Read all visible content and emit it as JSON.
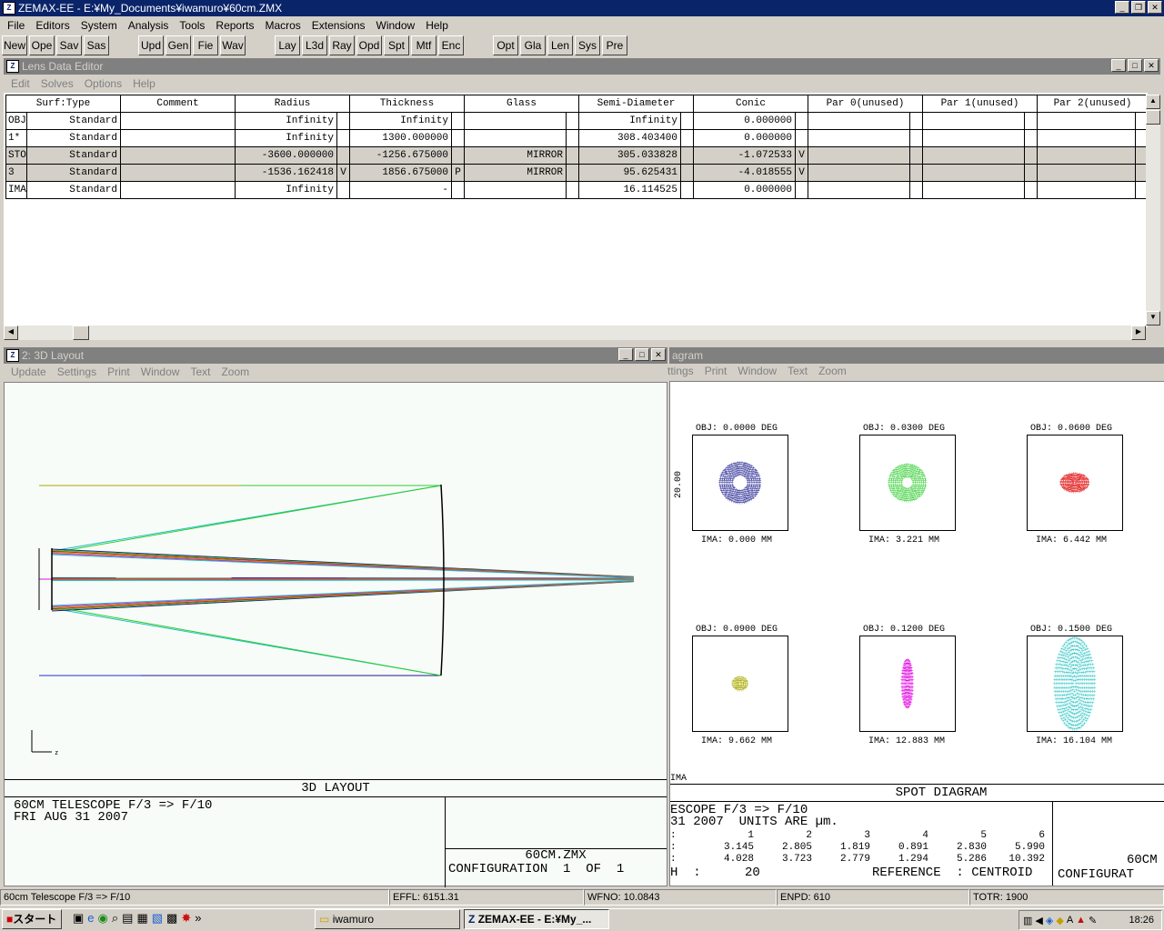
{
  "app": {
    "title": "ZEMAX-EE - E:¥My_Documents¥iwamuro¥60cm.ZMX"
  },
  "menu": [
    "File",
    "Editors",
    "System",
    "Analysis",
    "Tools",
    "Reports",
    "Macros",
    "Extensions",
    "Window",
    "Help"
  ],
  "toolbar": {
    "group1": [
      "New",
      "Ope",
      "Sav",
      "Sas"
    ],
    "group2": [
      "Upd",
      "Gen",
      "Fie",
      "Wav"
    ],
    "group3": [
      "Lay",
      "L3d",
      "Ray",
      "Opd",
      "Spt",
      "Mtf",
      "Enc"
    ],
    "group4": [
      "Opt",
      "Gla",
      "Len",
      "Sys",
      "Pre"
    ]
  },
  "lde": {
    "title": "Lens Data Editor",
    "menu": [
      "Edit",
      "Solves",
      "Options",
      "Help"
    ],
    "headers": [
      "Surf:Type",
      "Comment",
      "Radius",
      "Thickness",
      "Glass",
      "Semi-Diameter",
      "Conic",
      "Par 0(unused)",
      "Par 1(unused)",
      "Par 2(unused)"
    ],
    "rows": [
      {
        "surf": "OBJ",
        "type": "Standard",
        "comment": "",
        "radius": "Infinity",
        "rs": "",
        "thick": "Infinity",
        "ts": "",
        "glass": "",
        "semi": "Infinity",
        "conic": "0.000000",
        "cs": ""
      },
      {
        "surf": "1*",
        "type": "Standard",
        "comment": "",
        "radius": "Infinity",
        "rs": "",
        "thick": "1300.000000",
        "ts": "",
        "glass": "",
        "semi": "308.403400",
        "conic": "0.000000",
        "cs": ""
      },
      {
        "surf": "STO",
        "type": "Standard",
        "comment": "",
        "radius": "-3600.000000",
        "rs": "",
        "thick": "-1256.675000",
        "ts": "",
        "glass": "MIRROR",
        "semi": "305.033828",
        "conic": "-1.072533",
        "cs": "V"
      },
      {
        "surf": "3",
        "type": "Standard",
        "comment": "",
        "radius": "-1536.162418",
        "rs": "V",
        "thick": "1856.675000",
        "ts": "P",
        "glass": "MIRROR",
        "semi": "95.625431",
        "conic": "-4.018555",
        "cs": "V"
      },
      {
        "surf": "IMA",
        "type": "Standard",
        "comment": "",
        "radius": "Infinity",
        "rs": "",
        "thick": "-",
        "ts": "",
        "glass": "",
        "semi": "16.114525",
        "conic": "0.000000",
        "cs": ""
      }
    ]
  },
  "layout": {
    "title": "2: 3D Layout",
    "menu": [
      "Update",
      "Settings",
      "Print",
      "Window",
      "Text",
      "Zoom"
    ],
    "caption": "3D LAYOUT",
    "info1": "60CM TELESCOPE F/3 => F/10",
    "info2": "FRI AUG 31 2007",
    "file": "60CM.ZMX",
    "config": "CONFIGURATION  1  OF  1",
    "axis_z": "z"
  },
  "spot": {
    "title": "agram",
    "menu": [
      "ttings",
      "Print",
      "Window",
      "Text",
      "Zoom"
    ],
    "caption": "SPOT DIAGRAM",
    "scale_label": "20.00",
    "fields": [
      {
        "obj": "OBJ: 0.0000 DEG",
        "ima": "IMA: 0.000 MM",
        "color": "#1a1a8c"
      },
      {
        "obj": "OBJ: 0.0300 DEG",
        "ima": "IMA: 3.221 MM",
        "color": "#2ecc2e"
      },
      {
        "obj": "OBJ: 0.0600 DEG",
        "ima": "IMA: 6.442 MM",
        "color": "#e01010"
      },
      {
        "obj": "OBJ: 0.0900 DEG",
        "ima": "IMA: 9.662 MM",
        "color": "#a8a800"
      },
      {
        "obj": "OBJ: 0.1200 DEG",
        "ima": "IMA: 12.883 MM",
        "color": "#e010e0"
      },
      {
        "obj": "OBJ: 0.1500 DEG",
        "ima": "IMA: 16.104 MM",
        "color": "#20c0c0"
      }
    ],
    "ima_cut": "IMA",
    "line1": "ESCOPE F/3 => F/10",
    "line2": "31 2007  UNITS ARE µm.",
    "cols": [
      "1",
      "2",
      "3",
      "4",
      "5",
      "6"
    ],
    "rms": [
      "3.145",
      "2.805",
      "1.819",
      "0.891",
      "2.830",
      "5.990"
    ],
    "geo": [
      "4.028",
      "3.723",
      "2.779",
      "1.294",
      "5.286",
      "10.392"
    ],
    "colon": ":",
    "h_label": "H  :",
    "h_val": "20",
    "reference": "REFERENCE  : CENTROID",
    "file": "60CM",
    "config": "CONFIGURAT"
  },
  "status": [
    "60cm Telescope F/3 => F/10",
    "EFFL: 6151.31",
    "WFNO: 10.0843",
    "ENPD: 610",
    "TOTR: 1900"
  ],
  "taskbar": {
    "start": "スタート",
    "tasks": [
      "iwamuro",
      "ZEMAX-EE - E:¥My_..."
    ],
    "time": "18:26"
  },
  "colors": {
    "title_active": "#0a246a",
    "title_inactive": "#808080",
    "face": "#d4d0c8"
  }
}
